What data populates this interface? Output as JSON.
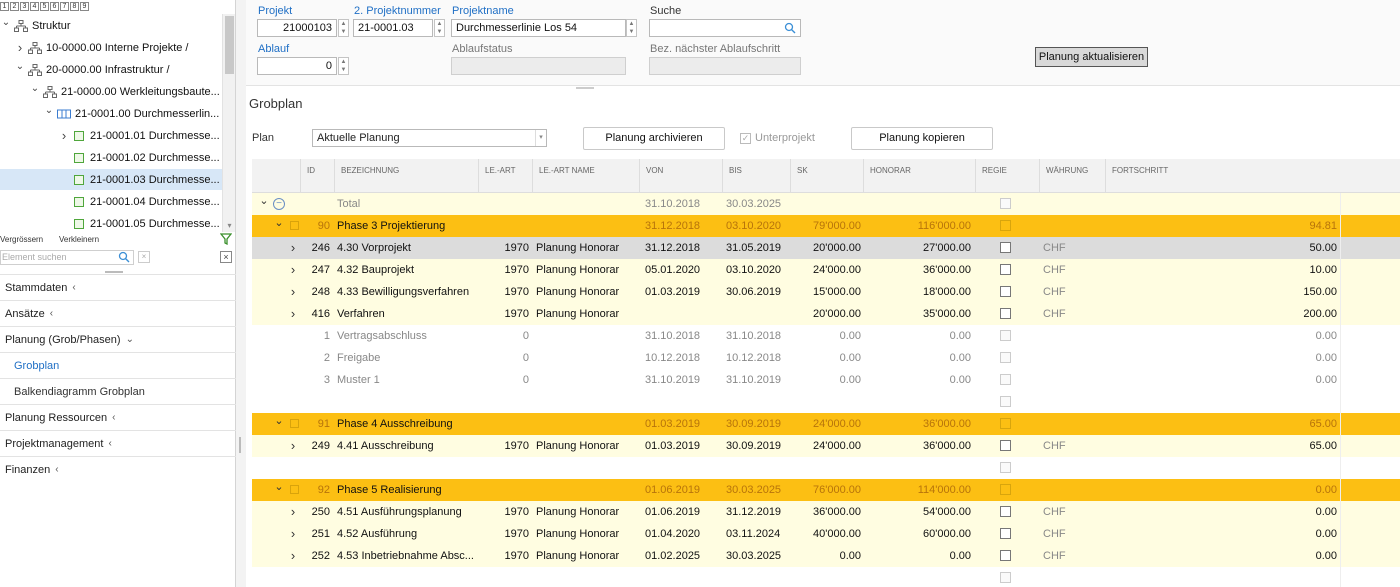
{
  "left": {
    "levels": [
      "1",
      "2",
      "3",
      "4",
      "5",
      "6",
      "7",
      "8",
      "9"
    ],
    "tree": [
      {
        "label": "Struktur",
        "chevron": "down",
        "icon": "hierarchy-icon"
      },
      {
        "label": "10-0000.00 Interne Projekte /",
        "chevron": "right",
        "icon": "hierarchy-icon"
      },
      {
        "label": "20-0000.00 Infrastruktur /",
        "chevron": "down",
        "icon": "hierarchy-icon"
      },
      {
        "label": "21-0000.00 Werkleitungsbaute...",
        "chevron": "down",
        "icon": "hierarchy-icon"
      },
      {
        "label": "21-0001.00 Durchmesserlin...",
        "chevron": "down",
        "icon": "project-icon"
      },
      {
        "label": "21-0001.01 Durchmesse...",
        "chevron": "right",
        "icon": "subproject-icon"
      },
      {
        "label": "21-0001.02 Durchmesse...",
        "chevron": "",
        "icon": "subproject-icon"
      },
      {
        "label": "21-0001.03 Durchmesse...",
        "chevron": "",
        "icon": "subproject-icon",
        "selected": true
      },
      {
        "label": "21-0001.04 Durchmesse...",
        "chevron": "",
        "icon": "subproject-icon"
      },
      {
        "label": "21-0001.05 Durchmesse...",
        "chevron": "",
        "icon": "subproject-icon"
      }
    ],
    "zoom_in": "Vergrössern",
    "zoom_out": "Verkleinern",
    "search_placeholder": "Element suchen",
    "nav": [
      {
        "label": "Stammdaten",
        "arrow": "‹",
        "type": "group"
      },
      {
        "label": "Ansätze",
        "arrow": "‹",
        "type": "group"
      },
      {
        "label": "Planung (Grob/Phasen)",
        "arrow": "⌄",
        "type": "group"
      },
      {
        "label": "Grobplan",
        "arrow": "",
        "type": "sub",
        "active": true
      },
      {
        "label": "Balkendiagramm Grobplan",
        "arrow": "",
        "type": "sub"
      },
      {
        "label": "Planung Ressourcen",
        "arrow": "‹",
        "type": "group"
      },
      {
        "label": "Projektmanagement",
        "arrow": "‹",
        "type": "group"
      },
      {
        "label": "Finanzen",
        "arrow": "‹",
        "type": "group"
      }
    ]
  },
  "header": {
    "projekt_label": "Projekt",
    "projekt_value": "21000103",
    "nr2_label": "2. Projektnummer",
    "nr2_value": "21-0001.03",
    "name_label": "Projektname",
    "name_value": "Durchmesserlinie Los 54",
    "suche_label": "Suche",
    "suche_value": "",
    "ablauf_label": "Ablauf",
    "ablauf_value": "0",
    "status_label": "Ablaufstatus",
    "next_label": "Bez. nächster Ablaufschritt",
    "refresh_button": "Planung aktualisieren"
  },
  "grobplan": {
    "title": "Grobplan",
    "plan_label": "Plan",
    "plan_value": "Aktuelle Planung",
    "archive_button": "Planung archivieren",
    "unterprojekt_label": "Unterprojekt",
    "copy_button": "Planung kopieren"
  },
  "grid": {
    "columns": [
      "ID",
      "Bezeichnung",
      "LE.-Art",
      "LE.-Art Name",
      "Von",
      "Bis",
      "SK",
      "Honorar",
      "Regie",
      "Währung",
      "Fortschritt"
    ],
    "rows": [
      {
        "type": "total",
        "expand": "down",
        "minus": true,
        "id": "",
        "name": "Total",
        "le": "",
        "lename": "",
        "von": "31.10.2018",
        "bis": "30.03.2025",
        "sk": "",
        "hon": "",
        "cur": "",
        "prog": ""
      },
      {
        "type": "phase",
        "expand": "down",
        "sq": true,
        "id": "90",
        "name": "Phase 3 Projektierung",
        "le": "",
        "lename": "",
        "von": "31.12.2018",
        "bis": "03.10.2020",
        "sk": "79'000.00",
        "hon": "116'000.00",
        "cur": "",
        "prog": "94.81"
      },
      {
        "type": "grey",
        "expand": "right",
        "id": "246",
        "name": "4.30 Vorprojekt",
        "le": "1970",
        "lename": "Planung Honorar",
        "von": "31.12.2018",
        "bis": "31.05.2019",
        "sk": "20'000.00",
        "hon": "27'000.00",
        "cur": "CHF",
        "prog": "50.00"
      },
      {
        "type": "yellow",
        "expand": "right",
        "id": "247",
        "name": "4.32 Bauprojekt",
        "le": "1970",
        "lename": "Planung Honorar",
        "von": "05.01.2020",
        "bis": "03.10.2020",
        "sk": "24'000.00",
        "hon": "36'000.00",
        "cur": "CHF",
        "prog": "10.00"
      },
      {
        "type": "yellow",
        "expand": "right",
        "id": "248",
        "name": "4.33 Bewilligungsverfahren",
        "le": "1970",
        "lename": "Planung Honorar",
        "von": "01.03.2019",
        "bis": "30.06.2019",
        "sk": "15'000.00",
        "hon": "18'000.00",
        "cur": "CHF",
        "prog": "150.00"
      },
      {
        "type": "yellow",
        "expand": "right",
        "id": "416",
        "name": "Verfahren",
        "le": "1970",
        "lename": "Planung Honorar",
        "von": "",
        "bis": "",
        "sk": "20'000.00",
        "hon": "35'000.00",
        "cur": "CHF",
        "prog": "200.00"
      },
      {
        "type": "light",
        "expand": "",
        "id": "1",
        "name": "Vertragsabschluss",
        "le": "0",
        "lename": "",
        "von": "31.10.2018",
        "bis": "31.10.2018",
        "sk": "0.00",
        "hon": "0.00",
        "cur": "",
        "prog": "0.00"
      },
      {
        "type": "light",
        "expand": "",
        "id": "2",
        "name": "Freigabe",
        "le": "0",
        "lename": "",
        "von": "10.12.2018",
        "bis": "10.12.2018",
        "sk": "0.00",
        "hon": "0.00",
        "cur": "",
        "prog": "0.00"
      },
      {
        "type": "light",
        "expand": "",
        "id": "3",
        "name": "Muster 1",
        "le": "0",
        "lename": "",
        "von": "31.10.2019",
        "bis": "31.10.2019",
        "sk": "0.00",
        "hon": "0.00",
        "cur": "",
        "prog": "0.00"
      },
      {
        "type": "light",
        "expand": "",
        "id": "",
        "name": "",
        "le": "",
        "lename": "",
        "von": "",
        "bis": "",
        "sk": "",
        "hon": "",
        "cur": "",
        "prog": ""
      },
      {
        "type": "phase",
        "expand": "down",
        "sq": true,
        "id": "91",
        "name": "Phase 4 Ausschreibung",
        "le": "",
        "lename": "",
        "von": "01.03.2019",
        "bis": "30.09.2019",
        "sk": "24'000.00",
        "hon": "36'000.00",
        "cur": "",
        "prog": "65.00"
      },
      {
        "type": "yellow",
        "expand": "right",
        "id": "249",
        "name": "4.41 Ausschreibung",
        "le": "1970",
        "lename": "Planung Honorar",
        "von": "01.03.2019",
        "bis": "30.09.2019",
        "sk": "24'000.00",
        "hon": "36'000.00",
        "cur": "CHF",
        "prog": "65.00"
      },
      {
        "type": "light",
        "expand": "",
        "id": "",
        "name": "",
        "le": "",
        "lename": "",
        "von": "",
        "bis": "",
        "sk": "",
        "hon": "",
        "cur": "",
        "prog": ""
      },
      {
        "type": "phase",
        "expand": "down",
        "sq": true,
        "id": "92",
        "name": "Phase 5 Realisierung",
        "le": "",
        "lename": "",
        "von": "01.06.2019",
        "bis": "30.03.2025",
        "sk": "76'000.00",
        "hon": "114'000.00",
        "cur": "",
        "prog": "0.00"
      },
      {
        "type": "yellow",
        "expand": "right",
        "id": "250",
        "name": "4.51 Ausführungsplanung",
        "le": "1970",
        "lename": "Planung Honorar",
        "von": "01.06.2019",
        "bis": "31.12.2019",
        "sk": "36'000.00",
        "hon": "54'000.00",
        "cur": "CHF",
        "prog": "0.00"
      },
      {
        "type": "yellow",
        "expand": "right",
        "id": "251",
        "name": "4.52 Ausführung",
        "le": "1970",
        "lename": "Planung Honorar",
        "von": "01.04.2020",
        "bis": "03.11.2024",
        "sk": "40'000.00",
        "hon": "60'000.00",
        "cur": "CHF",
        "prog": "0.00"
      },
      {
        "type": "yellow",
        "expand": "right",
        "id": "252",
        "name": "4.53 Inbetriebnahme Absc...",
        "le": "1970",
        "lename": "Planung Honorar",
        "von": "01.02.2025",
        "bis": "30.03.2025",
        "sk": "0.00",
        "hon": "0.00",
        "cur": "CHF",
        "prog": "0.00"
      },
      {
        "type": "light",
        "expand": "",
        "id": "",
        "name": "",
        "le": "",
        "lename": "",
        "von": "",
        "bis": "",
        "sk": "",
        "hon": "",
        "cur": "",
        "prog": ""
      }
    ]
  }
}
